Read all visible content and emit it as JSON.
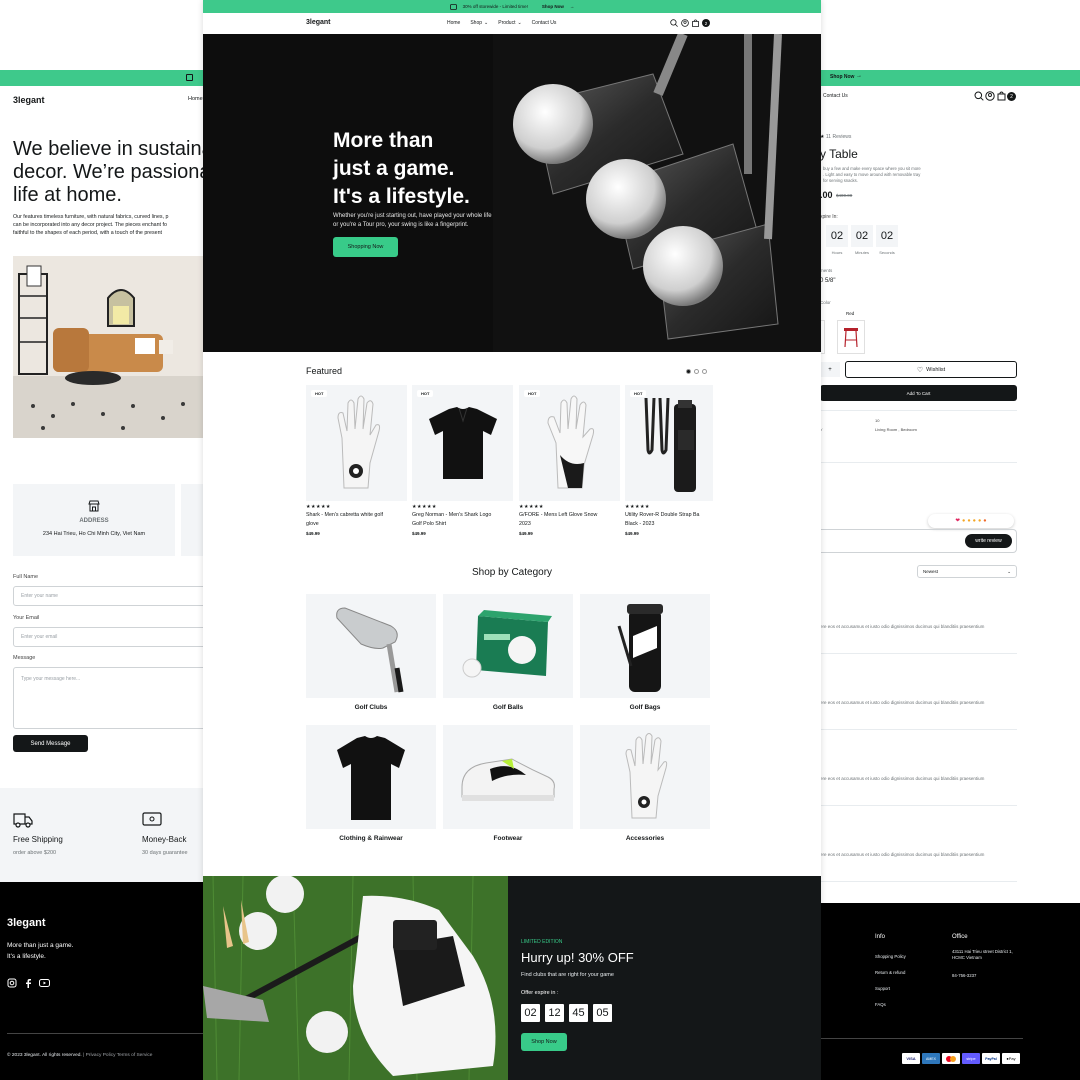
{
  "left_page": {
    "brand": "3legant",
    "nav_home": "Home",
    "heading": [
      "We believe in sustaina",
      "decor. We’re passiona",
      "life at home."
    ],
    "body": [
      "Our features timeless furniture, with natural fabrics, curved lines, p",
      "can be incorporated into any decor project. The pieces enchant fo",
      "faithful to the shapes of each period, with a touch of the present"
    ],
    "address_title": "ADDRESS",
    "address_value": "234 Hai Trieu, Ho Chi Minh City, Viet Nam",
    "form": {
      "full_name_label": "Full Name",
      "full_name_placeholder": "Enter your name",
      "email_label": "Your Email",
      "email_placeholder": "Enter your email",
      "message_label": "Message",
      "message_placeholder": "Type your message here...",
      "submit": "Send Message"
    },
    "features": [
      {
        "title": "Free Shipping",
        "sub": "order above $200"
      },
      {
        "title": "Money-Back",
        "sub": "30 days guarantee"
      }
    ],
    "footer": {
      "brand": "3legant",
      "tagline": [
        "More than just a game.",
        "It's a lifestyle."
      ],
      "copyright": "© 2023 3legant. All rights reserved.",
      "links": "| Privacy Policy  Terms of Service"
    }
  },
  "right_page": {
    "topbar_link": "Shop Now",
    "nav_contact": "Contact Us",
    "cart_count": "2",
    "reviews": "11 Reviews",
    "product_title": "y Table",
    "desc": [
      "buy a few and make every space where you sit more",
      ". Light and easy to move around with removable tray",
      "for serving snacks."
    ],
    "price": ".00",
    "old_price": "$400.00",
    "offer": "xpire In:",
    "countdown": [
      {
        "value": "02",
        "label": "Hours"
      },
      {
        "value": "02",
        "label": "Minutes"
      },
      {
        "value": "02",
        "label": "Seconds"
      }
    ],
    "measure_label": "ments",
    "measure_value": "0 5/8\"",
    "color_label": "Color",
    "color_red": "Red",
    "qty_plus": "+",
    "wishlist": "Wishlist",
    "add_to_cart": "Add To Cart",
    "meta_sku": "10",
    "meta_cat_key": "Y",
    "meta_cat": "Living Room , Bedroom",
    "write_review": "write review",
    "sort": "Newest",
    "review_text": "ere eos et accusamus et iusto odio dignissimos ducimus qui blanditiis praesentium",
    "footer_info": {
      "title": "Info",
      "links": [
        "Shopping Policy",
        "Return & refund",
        "Support",
        "FAQs"
      ]
    },
    "footer_office": {
      "title": "Office",
      "address": [
        "43111 Hai Trieu street District 1,",
        "HCMC Vietnam"
      ],
      "phone": "84-756-3237"
    },
    "payments": [
      "VISA",
      "AMEX",
      "MC",
      "stripe",
      "PayPal",
      "Pay"
    ]
  },
  "main": {
    "topbar": {
      "promo": "30% off storewide - Limited time!",
      "link": "Shop Now"
    },
    "nav": {
      "brand": "3legant",
      "items": [
        "Home",
        "Shop",
        "Product",
        "Contact Us"
      ],
      "cart_count": "2"
    },
    "hero": {
      "title": [
        "More than",
        "just a game.",
        "It's a lifestyle."
      ],
      "sub": [
        "Whether you're just starting out, have played your whole life",
        "or you're a Tour pro, your swing is like a fingerprint."
      ],
      "button": "Shopping Now"
    },
    "featured": {
      "title": "Featured",
      "products": [
        {
          "badge": "HOT",
          "name": [
            "Shark - Men's cabretta white golf",
            "glove"
          ],
          "price": "$49.99"
        },
        {
          "badge": "HOT",
          "name": [
            "Greg Norman - Men's Shark Logo",
            "Golf Polo Shirt"
          ],
          "price": "$49.99"
        },
        {
          "badge": "HOT",
          "name": [
            "G/FORE - Mens Left Glove Snow",
            "2023"
          ],
          "price": "$49.99"
        },
        {
          "badge": "HOT",
          "name": [
            "Utility Rover-R Double Strap Ba",
            "Black - 2023"
          ],
          "price": "$49.99"
        }
      ]
    },
    "categories": {
      "title": "Shop by Category",
      "items": [
        "Golf Clubs",
        "Golf Balls",
        "Golf Bags",
        "Clothing & Rainwear",
        "Footwear",
        "Accessories"
      ]
    },
    "promo": {
      "eyebrow": "LIMITED EDITION",
      "title": "Hurry up! 30% OFF",
      "sub": "Find clubs that are right for your game",
      "offer_label": "Offer expire in :",
      "countdown": [
        "02",
        "12",
        "45",
        "05"
      ],
      "button": "Shop Now"
    }
  },
  "colors": {
    "accent": "#38cb89",
    "dark": "#141718",
    "panel": "#f3f5f7"
  }
}
